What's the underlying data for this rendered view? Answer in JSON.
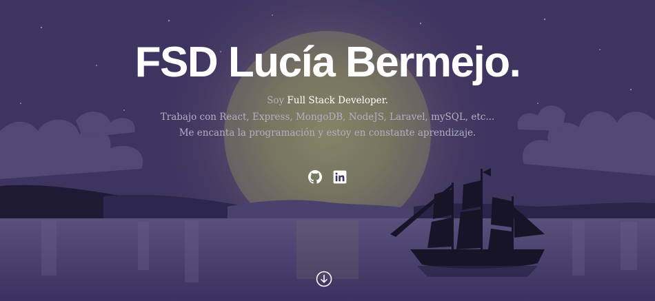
{
  "hero": {
    "title": "FSD Lucía Bermejo.",
    "intro_prefix": "Soy ",
    "intro_role": "Full Stack Developer.",
    "tech_line": "Trabajo con React, Express, MongoDB, NodeJS, Laravel, mySQL, etc...",
    "passion_line": "Me encanta la programación y estoy en constante aprendizaje."
  },
  "social": [
    {
      "icon": "github-icon"
    },
    {
      "icon": "linkedin-icon"
    }
  ],
  "scroll": {
    "icon": "arrow-down-circle-icon"
  },
  "colors": {
    "sky": "#3e3460",
    "moon_glow": "#8a8a6a",
    "water": "#4a3f72",
    "silhouette": "#17142b",
    "text_muted": "#b4afc4",
    "text_bright": "#ffffff"
  }
}
